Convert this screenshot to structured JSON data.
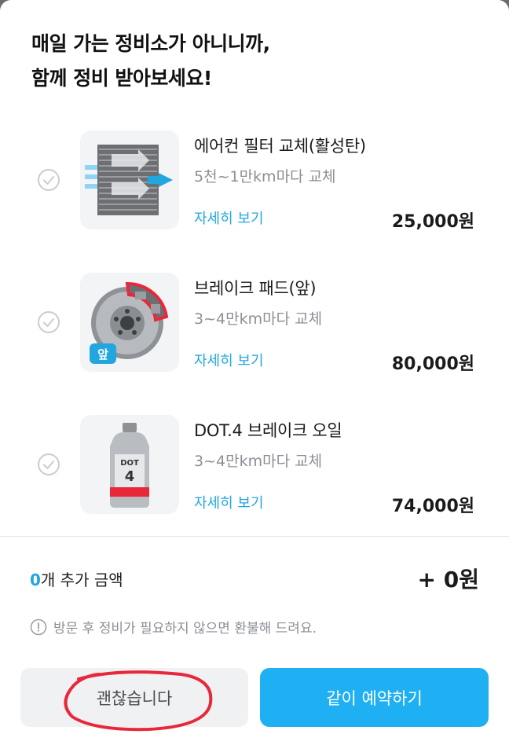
{
  "heading": {
    "line1": "매일 가는 정비소가 아니니까,",
    "line2": "함께 정비 받아보세요!"
  },
  "items": [
    {
      "name": "에어컨 필터 교체(활성탄)",
      "cycle": "5천~1만km마다 교체",
      "link": "자세히 보기",
      "price": "25,000원",
      "icon": "ac-filter-icon"
    },
    {
      "name": "브레이크 패드(앞)",
      "cycle": "3~4만km마다 교체",
      "link": "자세히 보기",
      "price": "80,000원",
      "icon": "brake-pad-icon",
      "badge": "앞"
    },
    {
      "name": "DOT.4 브레이크 오일",
      "cycle": "3~4만km마다 교체",
      "link": "자세히 보기",
      "price": "74,000원",
      "icon": "brake-oil-icon",
      "bottle_label_top": "DOT",
      "bottle_label_num": "4"
    }
  ],
  "summary": {
    "count": "0",
    "count_suffix": "개 추가 금액",
    "total": "+ 0원"
  },
  "notice": "방문 후 정비가 필요하지 않으면 환불해 드려요.",
  "buttons": {
    "decline": "괜찮습니다",
    "book": "같이 예약하기"
  },
  "colors": {
    "accent": "#22a6e0",
    "primary_button": "#1fb0f3",
    "secondary_button": "#f0f1f3",
    "annotation": "#e8283a"
  }
}
